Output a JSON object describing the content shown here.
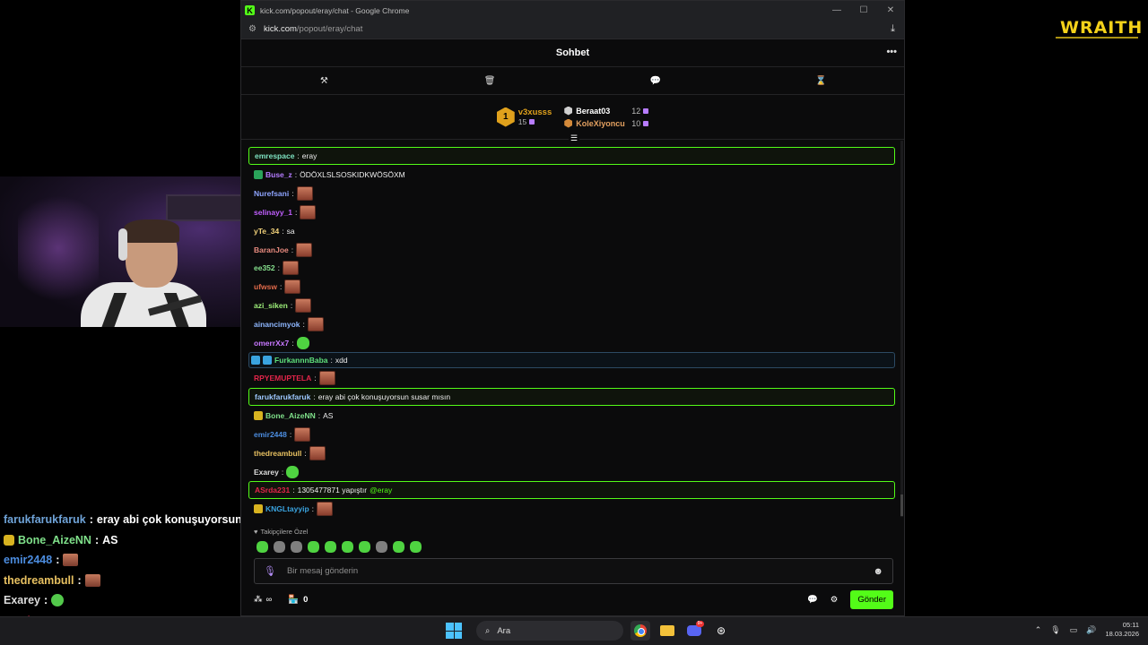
{
  "browser": {
    "title": "kick.com/popout/eray/chat - Google Chrome",
    "url_host": "kick.com",
    "url_path": "/popout/eray/chat"
  },
  "overlay": {
    "brand": "WRAITH",
    "chat": [
      {
        "user": "farukfarukfaruk",
        "sep": " : ",
        "text": "eray abi çok konuşuyorsun susar",
        "color": "#6fa3d8"
      },
      {
        "user": "Bone_AizeNN",
        "sep": " : ",
        "text": "AS",
        "color": "#7fe08a"
      },
      {
        "user": "emir2448",
        "sep": " : ",
        "text": "",
        "color": "#4c8de0"
      },
      {
        "user": "thedreambull",
        "sep": " : ",
        "text": "",
        "color": "#e7c061"
      },
      {
        "user": "Exarey",
        "sep": " : ",
        "text": "",
        "color": "#dddddd"
      },
      {
        "user": "ASrda231",
        "sep": " : ",
        "text": "1305477871 yapıştır @eray",
        "color": "#e2254a"
      },
      {
        "user": "KNGLtayyip",
        "sep": " : ",
        "text": "",
        "color": "#3aa4e0"
      }
    ]
  },
  "chat": {
    "header_title": "Sohbet",
    "tool_icons": [
      "hammer-icon",
      "trash-icon",
      "chat-bubble-icon",
      "hourglass-icon"
    ],
    "leaderboard": {
      "first": {
        "rank": "1",
        "name": "v3xusss",
        "count": "15"
      },
      "second": {
        "name": "Beraat03",
        "count": "12"
      },
      "third": {
        "name": "KoleXiyoncu",
        "count": "10"
      }
    },
    "messages": [
      {
        "user": "emrespace",
        "sep": ": ",
        "text": "eray",
        "color": "#7fe4c3",
        "style": "hl"
      },
      {
        "user": "Buse_z",
        "sep": ": ",
        "text": "ÖDÖXLSLSOSKIDKWÖSÖXM",
        "color": "#b57cff",
        "badge": "#2aa35a"
      },
      {
        "user": "Nurefsani",
        "sep": ": ",
        "text": "",
        "color": "#8ea4ff",
        "emote": true
      },
      {
        "user": "selinayy_1",
        "sep": ": ",
        "text": "",
        "color": "#c15fff",
        "emote": true
      },
      {
        "user": "yTe_34",
        "sep": ": ",
        "text": "sa",
        "color": "#f2d27a"
      },
      {
        "user": "BaranJoe",
        "sep": ": ",
        "text": "",
        "color": "#e78a7e",
        "emote": true
      },
      {
        "user": "ee352",
        "sep": ": ",
        "text": "",
        "color": "#86e08d",
        "emote": true
      },
      {
        "user": "ufwsw",
        "sep": ": ",
        "text": "",
        "color": "#e06a4a",
        "emote": true
      },
      {
        "user": "azi_siken",
        "sep": ": ",
        "text": "",
        "color": "#9ef07a",
        "emote": true
      },
      {
        "user": "ainancimyok",
        "sep": ": ",
        "text": "",
        "color": "#8eb7ff",
        "emote": true
      },
      {
        "user": "omerrXx7",
        "sep": ": ",
        "text": "",
        "color": "#c878ff",
        "gemote": true
      },
      {
        "user": "FurkannnBaba",
        "sep": ": ",
        "text": "xdd",
        "color": "#5fe07b",
        "style": "hlblue",
        "badge": "#3aa4e0"
      },
      {
        "user": "RPYEMUPTELA",
        "sep": ": ",
        "text": "",
        "color": "#e2254a",
        "emote": true
      },
      {
        "user": "farukfarukfaruk",
        "sep": ": ",
        "text": "eray abi çok konuşuyorsun susar mısın",
        "color": "#9ec8ff",
        "style": "hl"
      },
      {
        "user": "Bone_AizeNN",
        "sep": ": ",
        "text": "AS",
        "color": "#7fe08a",
        "badge": "#d8b320"
      },
      {
        "user": "emir2448",
        "sep": ": ",
        "text": "",
        "color": "#4c8de0",
        "emote": true
      },
      {
        "user": "thedreambull",
        "sep": ": ",
        "text": "",
        "color": "#e7c061",
        "emote": true
      },
      {
        "user": "Exarey",
        "sep": ": ",
        "text": "",
        "color": "#dddddd",
        "gemote": true
      },
      {
        "user": "ASrda231",
        "sep": ": ",
        "text": "1305477871 yapıştır ",
        "mention": "@eray",
        "color": "#e2254a",
        "style": "hl"
      },
      {
        "user": "KNGLtayyip",
        "sep": ": ",
        "text": "",
        "color": "#3aa4e0",
        "emote": true,
        "badge": "#d8b320"
      }
    ],
    "followers_label": "Takipçilere Özel",
    "input_placeholder": "Bir mesaj gönderin",
    "points_label": "∞",
    "store_count": "0",
    "send_label": "Gönder",
    "accent": "#53fc18"
  },
  "taskbar": {
    "search_label": "Ara",
    "discord_badge": "9+",
    "time": "05:11",
    "date": "18.03.2026"
  }
}
